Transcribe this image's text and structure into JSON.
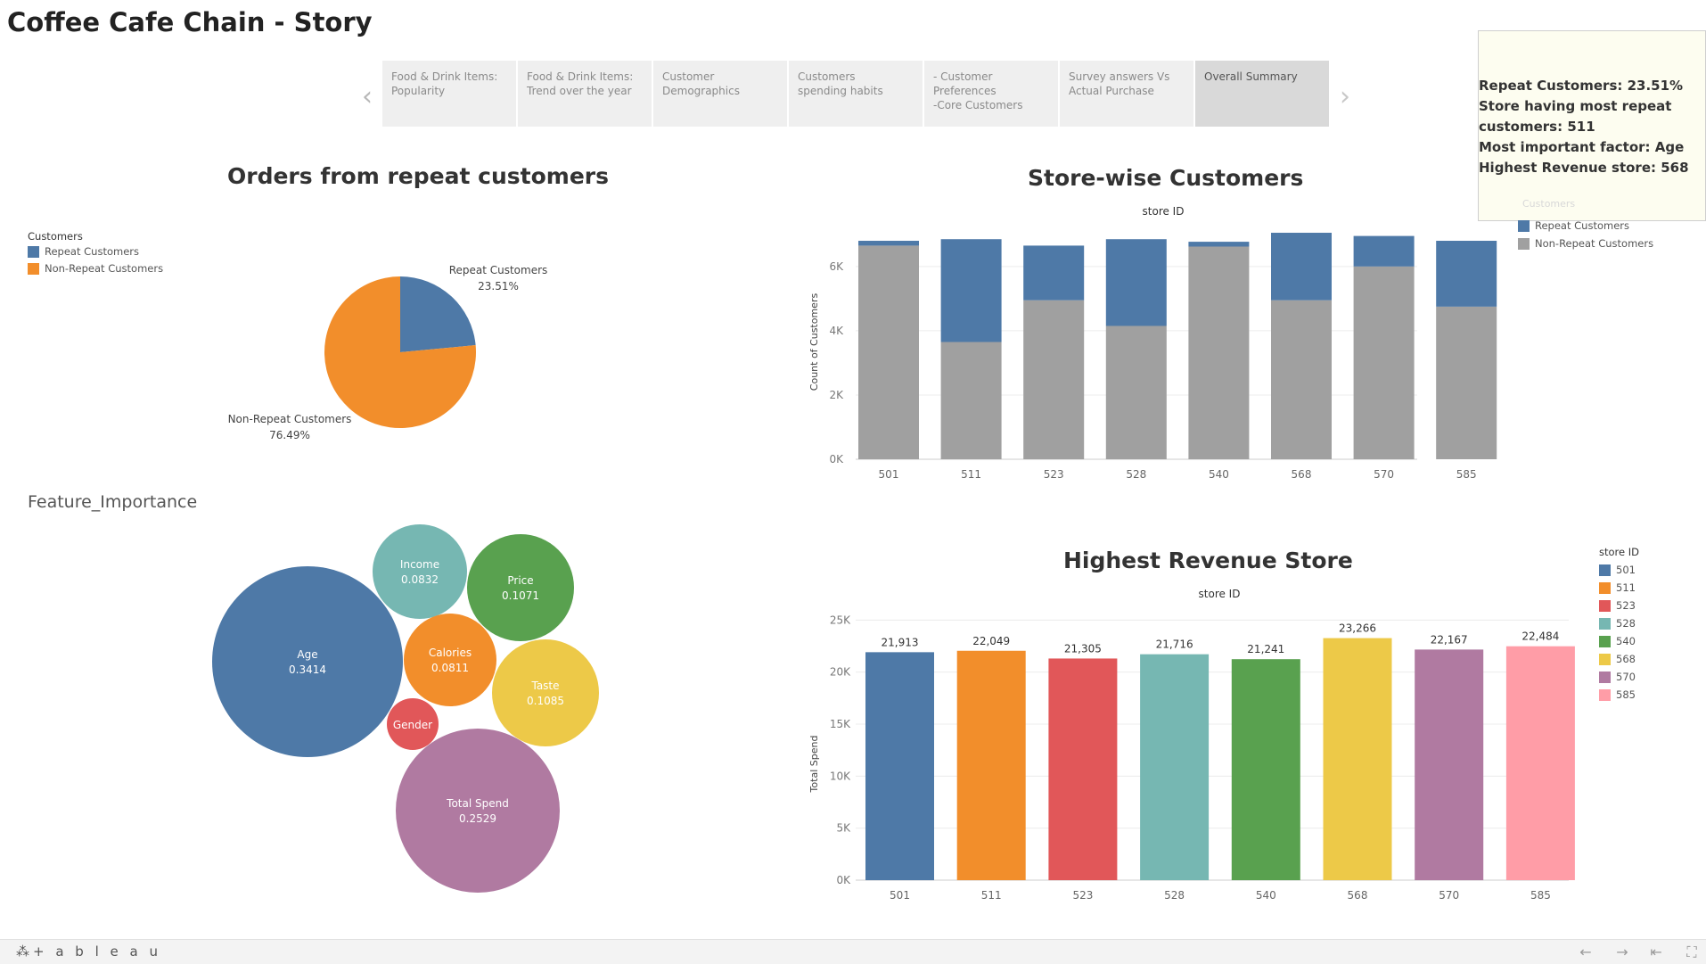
{
  "story_title": "Coffee Cafe Chain - Story",
  "nav": {
    "prev_icon": "chevron-left-icon",
    "next_icon": "chevron-right-icon"
  },
  "tabs": [
    {
      "label": "Food & Drink Items:\nPopularity"
    },
    {
      "label": "Food & Drink Items:\nTrend over the year"
    },
    {
      "label": "Customer\nDemographics"
    },
    {
      "label": "Customers\n spending habits"
    },
    {
      "label": "- Customer\nPreferences\n-Core Customers"
    },
    {
      "label": "Survey answers Vs\nActual Purchase"
    },
    {
      "label": "Overall Summary",
      "active": true
    }
  ],
  "summary": {
    "line1": "Repeat Customers: 23.51%",
    "line2": "Store having most repeat\ncustomers: 511",
    "line3": "Most important factor: Age",
    "line4": "Highest Revenue store: 568",
    "ghost_legend_title": "Customers"
  },
  "pie": {
    "title": "Orders from repeat customers",
    "legend_title": "Customers",
    "legend": [
      {
        "name": "Repeat Customers",
        "color": "#4e79a7"
      },
      {
        "name": "Non-Repeat Customers",
        "color": "#f28e2b"
      }
    ],
    "chart_data": {
      "type": "pie",
      "slices": [
        {
          "label": "Repeat Customers",
          "value": 23.51,
          "display": "23.51%",
          "color": "#4e79a7"
        },
        {
          "label": "Non-Repeat Customers",
          "value": 76.49,
          "display": "76.49%",
          "color": "#f28e2b"
        }
      ]
    }
  },
  "feature_importance": {
    "title": "Feature_Importance",
    "chart_data": {
      "type": "bubble",
      "items": [
        {
          "name": "Age",
          "value": 0.3414,
          "display": "0.3414",
          "color": "#4e79a7"
        },
        {
          "name": "Total Spend",
          "value": 0.2529,
          "display": "0.2529",
          "color": "#b07aa1"
        },
        {
          "name": "Taste",
          "value": 0.1085,
          "display": "0.1085",
          "color": "#edc948"
        },
        {
          "name": "Price",
          "value": 0.1071,
          "display": "0.1071",
          "color": "#59a14f"
        },
        {
          "name": "Income",
          "value": 0.0832,
          "display": "0.0832",
          "color": "#76b7b2"
        },
        {
          "name": "Calories",
          "value": 0.0811,
          "display": "0.0811",
          "color": "#f28e2b"
        },
        {
          "name": "Gender",
          "value": null,
          "display": "",
          "color": "#e15759"
        }
      ]
    }
  },
  "store_wise": {
    "title": "Store-wise Customers",
    "header": "store ID",
    "legend": [
      {
        "name": "Repeat Customers",
        "color": "#4e79a7"
      },
      {
        "name": "Non-Repeat Customers",
        "color": "#a0a0a0"
      }
    ],
    "chart_data": {
      "type": "bar",
      "stacked": true,
      "categories": [
        "501",
        "511",
        "523",
        "528",
        "540",
        "568",
        "570",
        "585"
      ],
      "series": [
        {
          "name": "Non-Repeat Customers",
          "values": [
            6650,
            3650,
            4950,
            4150,
            6620,
            4950,
            6000,
            4750
          ],
          "color": "#a0a0a0"
        },
        {
          "name": "Repeat Customers",
          "values": [
            150,
            3200,
            1700,
            2700,
            150,
            2100,
            950,
            2050
          ],
          "color": "#4e79a7"
        }
      ],
      "ylabel": "Count of Customers",
      "yticks": [
        0,
        2000,
        4000,
        6000
      ],
      "ytick_labels": [
        "0K",
        "2K",
        "4K",
        "6K"
      ],
      "ylim": [
        0,
        7300
      ],
      "grid": true
    }
  },
  "revenue": {
    "title": "Highest Revenue Store",
    "header": "store ID",
    "legend_title": "store ID",
    "chart_data": {
      "type": "bar",
      "categories": [
        "501",
        "511",
        "523",
        "528",
        "540",
        "568",
        "570",
        "585"
      ],
      "values": [
        21913,
        22049,
        21305,
        21716,
        21241,
        23266,
        22167,
        22484
      ],
      "labels": [
        "21,913",
        "22,049",
        "21,305",
        "21,716",
        "21,241",
        "23,266",
        "22,167",
        "22,484"
      ],
      "colors": [
        "#4e79a7",
        "#f28e2b",
        "#e15759",
        "#76b7b2",
        "#59a14f",
        "#edc948",
        "#b07aa1",
        "#ff9da7"
      ],
      "ylabel": "Total Spend",
      "yticks": [
        0,
        5000,
        10000,
        15000,
        20000,
        25000
      ],
      "ytick_labels": [
        "0K",
        "5K",
        "10K",
        "15K",
        "20K",
        "25K"
      ],
      "ylim": [
        0,
        25800
      ],
      "grid": true
    }
  },
  "footer": {
    "brand": "+ a b l e a u",
    "buttons": [
      "undo-icon",
      "redo-icon",
      "revert-icon",
      "fullscreen-icon"
    ],
    "glyphs": [
      "←",
      "→",
      "⇤",
      "⛶"
    ]
  }
}
